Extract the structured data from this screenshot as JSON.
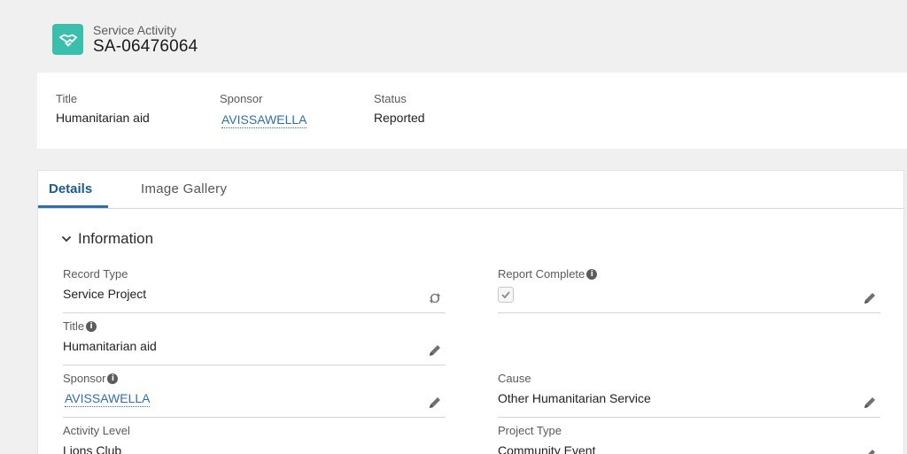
{
  "header": {
    "icon": "handshake-icon",
    "object_type": "Service Activity",
    "record_name": "SA-06476064",
    "accent_color": "#3bbfad"
  },
  "highlights": {
    "title": {
      "label": "Title",
      "value": "Humanitarian aid"
    },
    "sponsor": {
      "label": "Sponsor",
      "value": "AVISSAWELLA"
    },
    "status": {
      "label": "Status",
      "value": "Reported"
    }
  },
  "tabs": [
    {
      "label": "Details",
      "active": true
    },
    {
      "label": "Image Gallery",
      "active": false
    }
  ],
  "section": {
    "title": "Information",
    "fields": {
      "record_type": {
        "label": "Record Type",
        "value": "Service Project",
        "action_icon": "change-record-type-icon"
      },
      "report_complete": {
        "label": "Report Complete",
        "checked": true
      },
      "title": {
        "label": "Title",
        "value": "Humanitarian aid"
      },
      "sponsor": {
        "label": "Sponsor",
        "value": "AVISSAWELLA"
      },
      "cause": {
        "label": "Cause",
        "value": "Other Humanitarian Service"
      },
      "activity_level": {
        "label": "Activity Level",
        "value": "Lions Club"
      },
      "project_type": {
        "label": "Project Type",
        "value": "Community Event"
      }
    }
  },
  "colors": {
    "link": "#2d6fb0",
    "tab_active": "#1d5a8e"
  }
}
